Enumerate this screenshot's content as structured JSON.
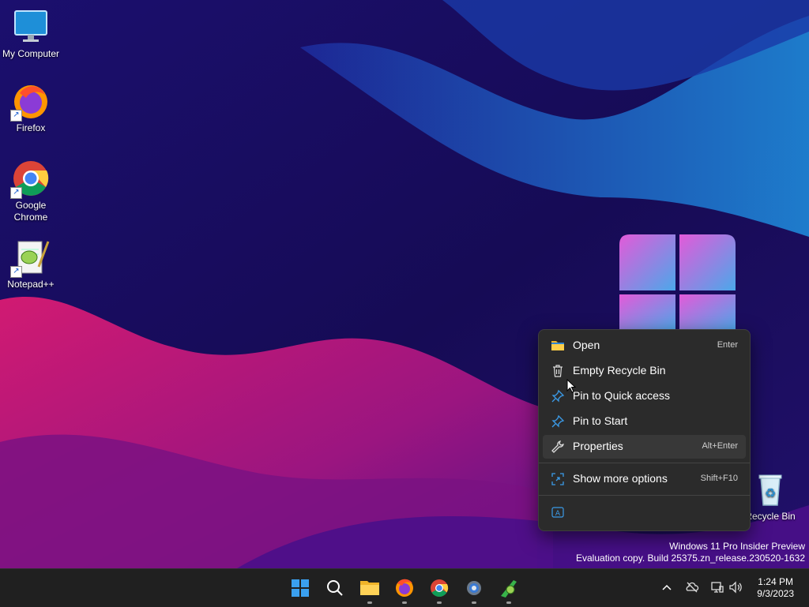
{
  "desktop": {
    "icons": [
      {
        "label": "My Computer",
        "icon": "monitor-icon"
      },
      {
        "label": "Firefox",
        "icon": "firefox-icon"
      },
      {
        "label": "Google\nChrome",
        "icon": "chrome-icon"
      },
      {
        "label": "Notepad++",
        "icon": "notepadpp-icon"
      },
      {
        "label": "Recycle Bin",
        "icon": "recycle-bin-icon"
      }
    ]
  },
  "context_menu": {
    "items": [
      {
        "label": "Open",
        "shortcut": "Enter",
        "icon": "folder-icon"
      },
      {
        "label": "Empty Recycle Bin",
        "shortcut": "",
        "icon": "trash-icon"
      },
      {
        "label": "Pin to Quick access",
        "shortcut": "",
        "icon": "pin-icon"
      },
      {
        "label": "Pin to Start",
        "shortcut": "",
        "icon": "pin-icon"
      },
      {
        "label": "Properties",
        "shortcut": "Alt+Enter",
        "icon": "wrench-icon"
      },
      {
        "label": "Show more options",
        "shortcut": "Shift+F10",
        "icon": "expand-icon"
      }
    ],
    "bottom_icon": "ai-text-icon",
    "hovered": "Properties"
  },
  "watermark": {
    "line1": "Windows 11 Pro Insider Preview",
    "line2": "Evaluation copy. Build 25375.zn_release.230520-1632"
  },
  "taskbar": {
    "apps": [
      "start-icon",
      "search-icon",
      "file-explorer-icon",
      "firefox-icon",
      "chrome-icon",
      "settings-icon",
      "notepadpp-icon"
    ],
    "clock": {
      "time": "1:24 PM",
      "date": "9/3/2023"
    }
  },
  "colors": {
    "accent": "#3b9be8",
    "menu_bg": "#2b2b2b",
    "taskbar_bg": "#202020"
  }
}
